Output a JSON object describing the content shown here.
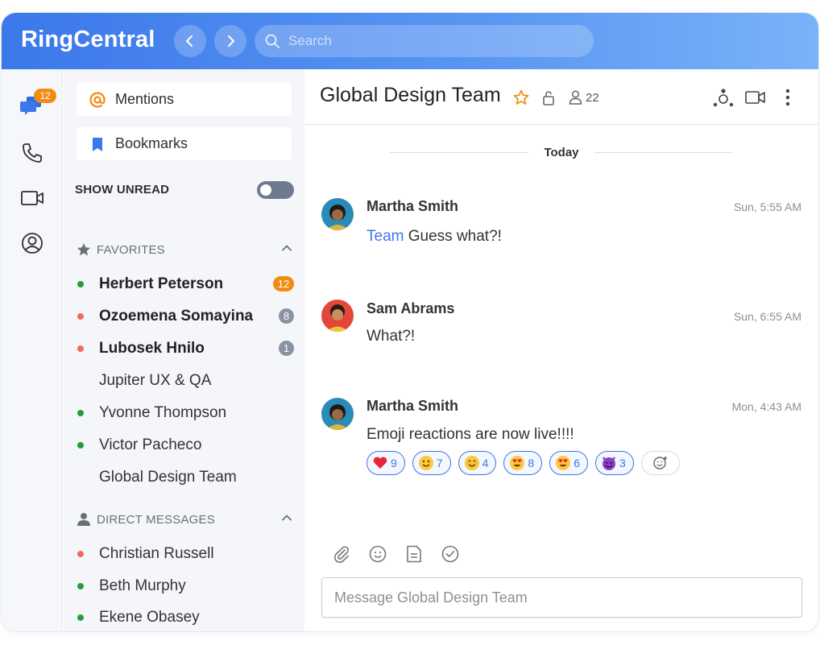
{
  "app": {
    "brand": "RingCentral"
  },
  "search": {
    "placeholder": "Search"
  },
  "rail": {
    "messages_badge": "12"
  },
  "sidebar": {
    "mentions": "Mentions",
    "bookmarks": "Bookmarks",
    "show_unread": "SHOW UNREAD",
    "favorites_header": "FAVORITES",
    "favorites": [
      {
        "name": "Herbert Peterson",
        "status": "green",
        "count": "12",
        "bold": true
      },
      {
        "name": "Ozoemena Somayina",
        "status": "red",
        "count": "8",
        "bold": true
      },
      {
        "name": "Lubosek Hnilo",
        "status": "red",
        "count": "1",
        "bold": true
      },
      {
        "name": "Jupiter UX & QA",
        "status": "none",
        "count": "",
        "bold": false
      },
      {
        "name": "Yvonne Thompson",
        "status": "green",
        "count": "",
        "bold": false
      },
      {
        "name": "Victor Pacheco",
        "status": "green",
        "count": "",
        "bold": false
      },
      {
        "name": "Global Design Team",
        "status": "none",
        "count": "",
        "bold": false
      }
    ],
    "dm_header": "DIRECT MESSAGES",
    "direct_messages": [
      {
        "name": "Christian Russell",
        "status": "red"
      },
      {
        "name": "Beth Murphy",
        "status": "green"
      },
      {
        "name": "Ekene Obasey",
        "status": "green"
      }
    ]
  },
  "conversation": {
    "title": "Global Design Team",
    "member_count": "22",
    "date_divider": "Today",
    "messages": [
      {
        "sender": "Martha Smith",
        "time": "Sun, 5:55 AM",
        "mention": "Team",
        "text": "Guess what?!"
      },
      {
        "sender": "Sam Abrams",
        "time": "Sun, 6:55 AM",
        "text": "What?!"
      },
      {
        "sender": "Martha Smith",
        "time": "Mon, 4:43 AM",
        "text": "Emoji reactions are now live!!!!"
      }
    ],
    "reactions": [
      {
        "emoji": "heart-icon",
        "count": "9"
      },
      {
        "emoji": "slightly-smiling-face-icon",
        "count": "7"
      },
      {
        "emoji": "smiling-face-icon",
        "count": "4"
      },
      {
        "emoji": "heart-eyes-icon",
        "count": "8"
      },
      {
        "emoji": "heart-eyes-icon",
        "count": "6"
      },
      {
        "emoji": "smiling-devil-icon",
        "count": "3"
      }
    ],
    "composer_placeholder": "Message Global Design Team"
  },
  "colors": {
    "accent": "#3b78ea",
    "badge_orange": "#f28b11",
    "online_green": "#1fa03a",
    "away_red": "#ef6b60"
  }
}
